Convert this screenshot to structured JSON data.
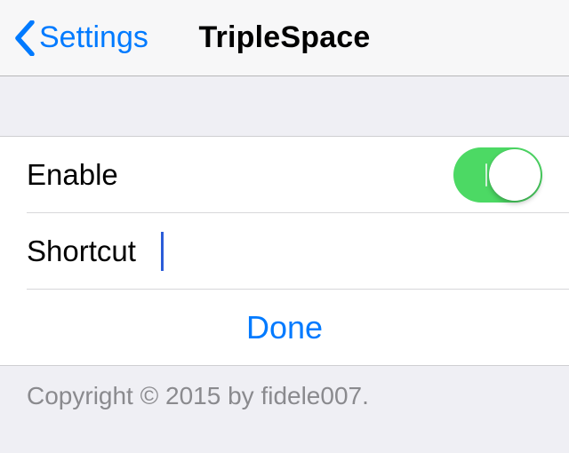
{
  "colors": {
    "accent": "#007aff",
    "toggle_on": "#4cd964",
    "caret": "#2b5cd9"
  },
  "nav": {
    "back_label": "Settings",
    "title": "TripleSpace"
  },
  "rows": {
    "enable": {
      "label": "Enable",
      "value": true
    },
    "shortcut": {
      "label": "Shortcut",
      "value": ""
    },
    "done": {
      "label": "Done"
    }
  },
  "footer": {
    "text": "Copyright © 2015 by fidele007."
  }
}
